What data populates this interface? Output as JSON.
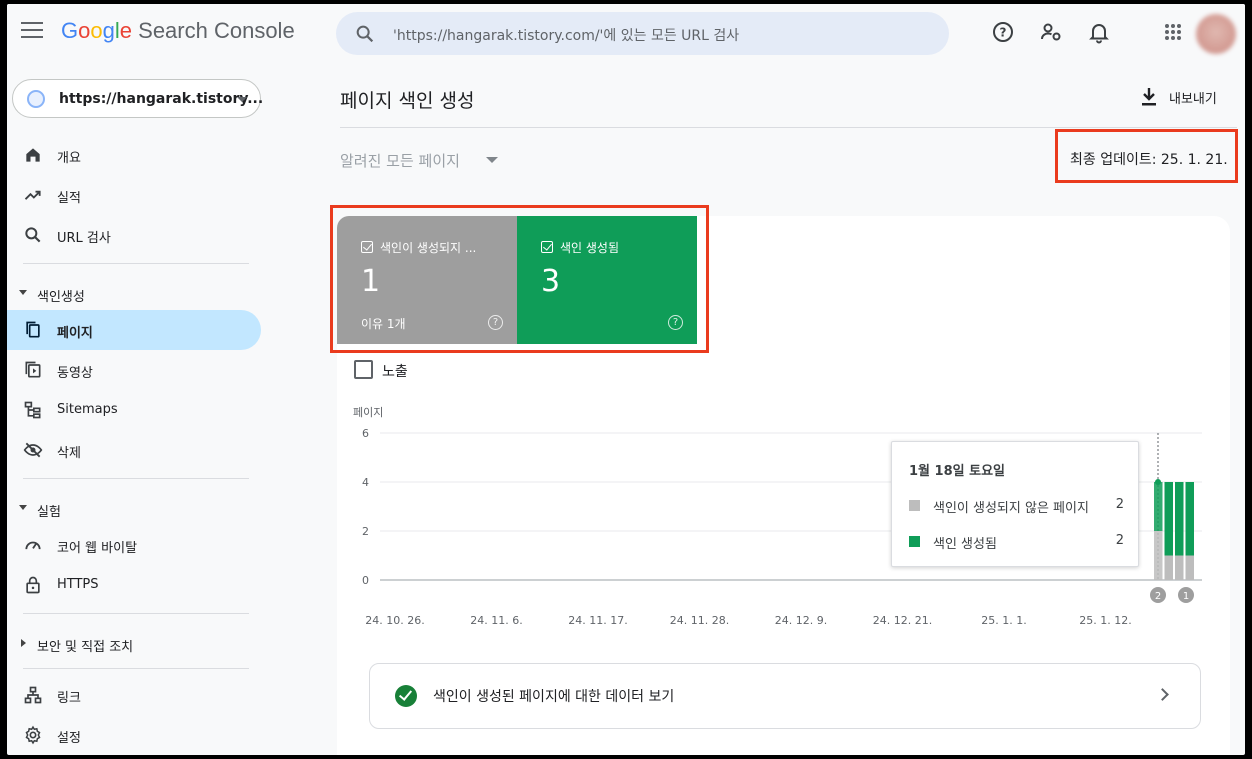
{
  "header": {
    "logo_google": "Google",
    "logo_product": "Search Console",
    "search_placeholder": "'https://hangarak.tistory.com/'에 있는 모든 URL 검사"
  },
  "sidebar": {
    "property": "https://hangarak.tistory...",
    "items_top": [
      {
        "label": "개요",
        "icon": "home-icon"
      },
      {
        "label": "실적",
        "icon": "trending-up-icon"
      },
      {
        "label": "URL 검사",
        "icon": "search-icon"
      }
    ],
    "section_indexing": "색인생성",
    "items_indexing": [
      {
        "label": "페이지",
        "icon": "pages-icon",
        "active": true
      },
      {
        "label": "동영상",
        "icon": "video-icon"
      },
      {
        "label": "Sitemaps",
        "icon": "sitemap-icon"
      },
      {
        "label": "삭제",
        "icon": "visibility-off-icon"
      }
    ],
    "section_experience": "실험",
    "items_experience": [
      {
        "label": "코어 웹 바이탈",
        "icon": "speed-gauge-icon"
      },
      {
        "label": "HTTPS",
        "icon": "lock-icon"
      }
    ],
    "section_security": "보안 및 직접 조치",
    "items_bottom": [
      {
        "label": "링크",
        "icon": "links-icon"
      },
      {
        "label": "설정",
        "icon": "settings-icon"
      }
    ]
  },
  "main": {
    "title": "페이지 색인 생성",
    "export_label": "내보내기",
    "filter_label": "알려진 모든 페이지",
    "last_updated": "최종 업데이트: 25. 1. 21.",
    "metric_not_indexed": {
      "label": "색인이 생성되지 ...",
      "value": "1",
      "sub": "이유 1개",
      "color": "#9e9e9e"
    },
    "metric_indexed": {
      "label": "색인 생성됨",
      "value": "3",
      "color": "#0f9d58"
    },
    "impressions_label": "노출",
    "view_indexed_link": "색인이 생성된 페이지에 대한 데이터 보기"
  },
  "tooltip": {
    "date": "1월 18일 토요일",
    "rows": [
      {
        "label": "색인이 생성되지 않은 페이지",
        "value": "2",
        "color": "#bdbdbd"
      },
      {
        "label": "색인 생성됨",
        "value": "2",
        "color": "#0f9d58"
      }
    ]
  },
  "chart_data": {
    "type": "bar",
    "ylabel": "페이지",
    "ylim": [
      0,
      6
    ],
    "yticks": [
      "6",
      "4",
      "2",
      "0"
    ],
    "x_tick_labels": [
      "24. 10. 26.",
      "24. 11. 6.",
      "24. 11. 17.",
      "24. 11. 28.",
      "24. 12. 9.",
      "24. 12. 21.",
      "25. 1. 1.",
      "25. 1. 12."
    ],
    "categories": [
      "25. 1. 18.",
      "25. 1. 19.",
      "25. 1. 20.",
      "25. 1. 21."
    ],
    "series": [
      {
        "name": "색인이 생성되지 않은 페이지",
        "color": "#bdbdbd",
        "values": [
          2,
          1,
          1,
          1
        ]
      },
      {
        "name": "색인 생성됨",
        "color": "#0f9d58",
        "values": [
          2,
          3,
          3,
          3
        ]
      }
    ],
    "annotations": [
      "2",
      "1"
    ]
  }
}
